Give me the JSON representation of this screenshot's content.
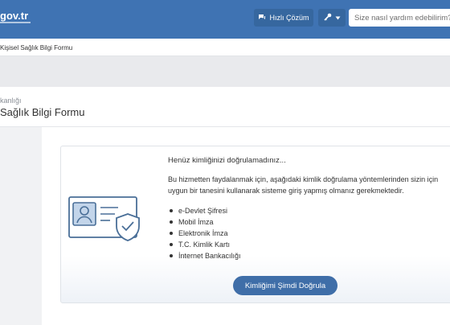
{
  "header": {
    "logo": "gov.tr",
    "quick_solution_label": "Hızlı Çözüm",
    "search": {
      "placeholder": "Size nasıl yardım edebilirim?"
    },
    "colors": {
      "bar": "#3f73b3",
      "button": "#36679f"
    },
    "icons": [
      "chat-icon",
      "key-icon",
      "chevron-down-icon"
    ]
  },
  "breadcrumb": {
    "current": "Kişisel Sağlık Bilgi Formu"
  },
  "page": {
    "subtitle": "kanlığı",
    "title": "Sağlık Bilgi Formu"
  },
  "notice": {
    "title": "Henüz kimliğinizi doğrulamadınız...",
    "description": "Bu hizmetten faydalanmak için, aşağıdaki kimlik doğrulama yöntemlerinden sizin için uygun bir tanesini kullanarak sisteme giriş yapmış olmanız gerekmektedir.",
    "methods": [
      "e-Devlet Şifresi",
      "Mobil İmza",
      "Elektronik İmza",
      "T.C. Kimlik Kartı",
      "İnternet Bankacılığı"
    ],
    "verify_button": "Kimliğimi Şimdi Doğrula",
    "illustration_icon": "id-card-shield-icon",
    "colors": {
      "illustration": "#4a6f98",
      "button": "#3f6ea8"
    }
  }
}
